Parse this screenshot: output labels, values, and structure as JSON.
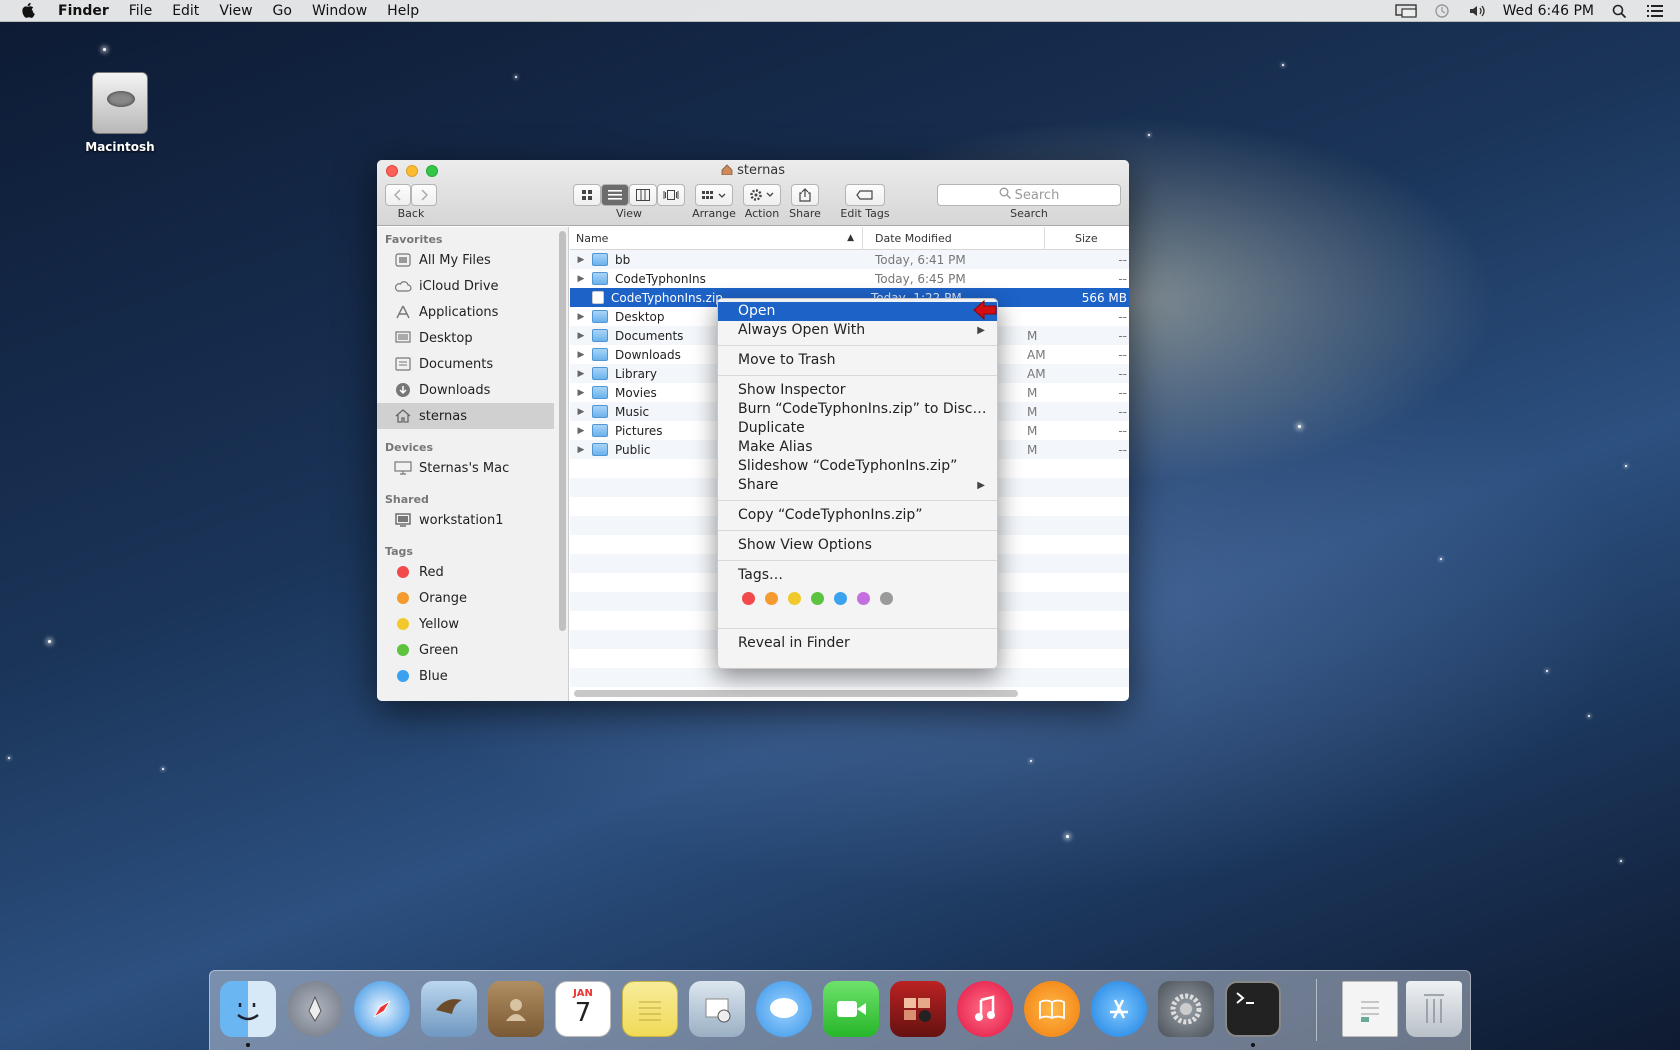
{
  "menubar": {
    "app": "Finder",
    "menus": [
      "File",
      "Edit",
      "View",
      "Go",
      "Window",
      "Help"
    ],
    "clock": "Wed 6:46 PM"
  },
  "desktop": {
    "drive_label": "Macintosh"
  },
  "window": {
    "title": "sternas",
    "toolbar": {
      "back_label": "Back",
      "view_label": "View",
      "arrange_label": "Arrange",
      "action_label": "Action",
      "share_label": "Share",
      "edit_tags_label": "Edit Tags",
      "search_placeholder": "Search",
      "search_label": "Search"
    },
    "sidebar": {
      "favorites_header": "Favorites",
      "favorites": [
        "All My Files",
        "iCloud Drive",
        "Applications",
        "Desktop",
        "Documents",
        "Downloads",
        "sternas"
      ],
      "devices_header": "Devices",
      "devices": [
        "Sternas's Mac"
      ],
      "shared_header": "Shared",
      "shared": [
        "workstation1"
      ],
      "tags_header": "Tags",
      "tags": [
        {
          "name": "Red",
          "color": "#f2494a"
        },
        {
          "name": "Orange",
          "color": "#f59a2e"
        },
        {
          "name": "Yellow",
          "color": "#f2c92c"
        },
        {
          "name": "Green",
          "color": "#5cc341"
        },
        {
          "name": "Blue",
          "color": "#3aa2ee"
        }
      ]
    },
    "columns": {
      "name": "Name",
      "date": "Date Modified",
      "size": "Size"
    },
    "rows": [
      {
        "name": "bb",
        "date": "Today, 6:41 PM",
        "size": "--"
      },
      {
        "name": "CodeTyphonIns",
        "date": "Today, 6:45 PM",
        "size": "--"
      },
      {
        "name": "CodeTyphonIns.zip",
        "date": "Today, 1:22 PM",
        "size": "566 MB"
      },
      {
        "name": "Desktop",
        "date": "",
        "size": "--"
      },
      {
        "name": "Documents",
        "date": "M",
        "size": "--"
      },
      {
        "name": "Downloads",
        "date": "AM",
        "size": "--"
      },
      {
        "name": "Library",
        "date": "AM",
        "size": "--"
      },
      {
        "name": "Movies",
        "date": "M",
        "size": "--"
      },
      {
        "name": "Music",
        "date": "M",
        "size": "--"
      },
      {
        "name": "Pictures",
        "date": "M",
        "size": "--"
      },
      {
        "name": "Public",
        "date": "M",
        "size": "--"
      }
    ]
  },
  "context_menu": {
    "open": "Open",
    "always_open_with": "Always Open With",
    "move_to_trash": "Move to Trash",
    "show_inspector": "Show Inspector",
    "burn": "Burn “CodeTyphonIns.zip” to Disc…",
    "duplicate": "Duplicate",
    "make_alias": "Make Alias",
    "slideshow": "Slideshow “CodeTyphonIns.zip”",
    "share": "Share",
    "copy": "Copy “CodeTyphonIns.zip”",
    "show_view_options": "Show View Options",
    "tags": "Tags…",
    "tag_colors": [
      "#f2494a",
      "#f59a2e",
      "#f2c92c",
      "#5cc341",
      "#3aa2ee",
      "#c36fe0",
      "#9a9a9a"
    ],
    "reveal_in_finder": "Reveal in Finder"
  },
  "dock": {
    "calendar_month": "JAN",
    "calendar_day": "7",
    "apps": [
      "finder-icon",
      "launchpad-icon",
      "safari-icon",
      "mail-icon",
      "contacts-icon",
      "calendar-icon",
      "notes-icon",
      "photo-preview-icon",
      "messages-icon",
      "facetime-icon",
      "photo-booth-icon",
      "itunes-icon",
      "ibooks-icon",
      "app-store-icon",
      "system-preferences-icon",
      "terminal-icon",
      "document-icon",
      "trash-icon"
    ]
  }
}
